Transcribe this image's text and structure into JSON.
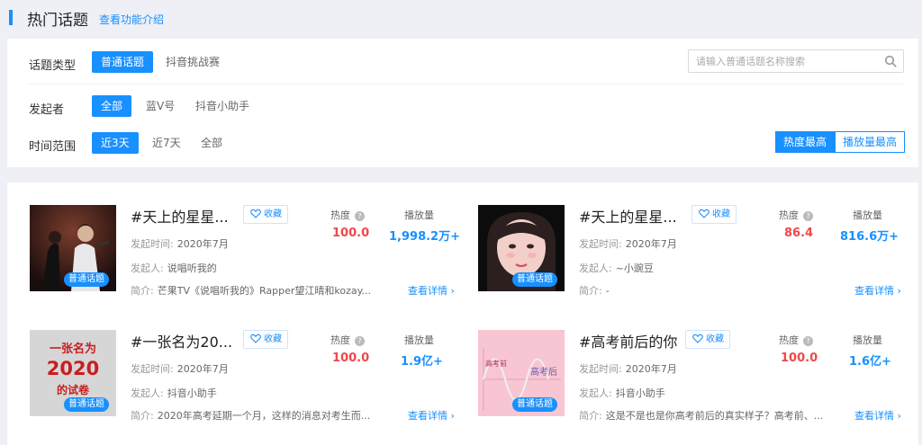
{
  "header": {
    "title": "热门话题",
    "intro_link": "查看功能介绍"
  },
  "filters": {
    "type_label": "话题类型",
    "type_options": [
      "普通话题",
      "抖音挑战赛"
    ],
    "initiator_label": "发起者",
    "initiator_options": [
      "全部",
      "蓝V号",
      "抖音小助手"
    ],
    "time_label": "时间范围",
    "time_options": [
      "近3天",
      "近7天",
      "全部"
    ],
    "search_placeholder": "请输入普通话题名称搜索",
    "sort_options": [
      "热度最高",
      "播放量最高"
    ]
  },
  "labels": {
    "heat": "热度",
    "plays": "播放量",
    "favorite": "收藏",
    "initiated_time": "发起时间:",
    "initiator": "发起人:",
    "intro": "简介:",
    "details": "查看详情",
    "badge": "普通话题"
  },
  "topics": [
    {
      "title": "#天上的星星...",
      "time": "2020年7月",
      "initiator": "说唱听我的",
      "intro": "芒果TV《说唱听我的》Rapper望江晴和kozay...",
      "heat": "100.0",
      "plays": "1,998.2万+",
      "cover_text": ""
    },
    {
      "title": "#天上的星星...",
      "time": "2020年7月",
      "initiator": "~小豌豆",
      "intro": "-",
      "heat": "86.4",
      "plays": "816.6万+",
      "cover_text": ""
    },
    {
      "title": "#一张名为20...",
      "time": "2020年7月",
      "initiator": "抖音小助手",
      "intro": "2020年高考延期一个月，这样的消息对考生而...",
      "heat": "100.0",
      "plays": "1.9亿+",
      "cover_text": ""
    },
    {
      "title": "#高考前后的你",
      "time": "2020年7月",
      "initiator": "抖音小助手",
      "intro": "这是不是也是你高考前后的真实样子？高考前、...",
      "heat": "100.0",
      "plays": "1.6亿+",
      "cover_text": ""
    }
  ],
  "covers": {
    "c3_line1": "一张名为",
    "c3_line2": "2020",
    "c3_line3": "的试卷",
    "c4_left": "高考前",
    "c4_right": "高考后"
  },
  "colors": {
    "accent": "#1890ff",
    "heat": "#f04848"
  },
  "icons": {
    "search": "search-icon",
    "favorite": "heart-icon",
    "help": "question-icon",
    "chevron": "chevron-right-icon"
  }
}
